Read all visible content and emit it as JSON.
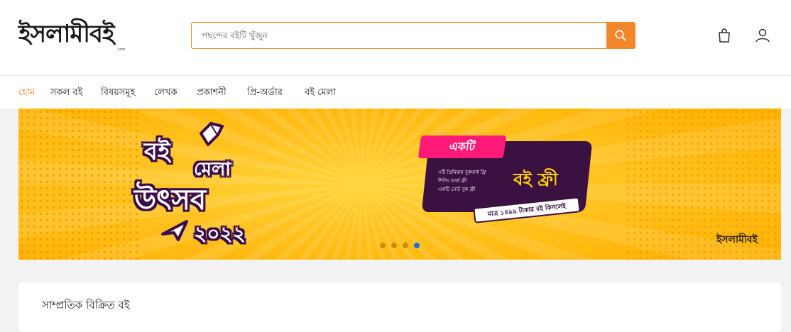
{
  "header": {
    "logo_text": "ইসলামীবই",
    "logo_sub": ".com",
    "search": {
      "placeholder": "পছন্দের বইটি খুঁজুন",
      "value": ""
    },
    "icons": {
      "search": "search-icon",
      "cart": "shopping-bag-icon",
      "account": "user-icon"
    }
  },
  "nav": {
    "items": [
      {
        "label": "হোম",
        "active": true
      },
      {
        "label": "সকল বই"
      },
      {
        "label": "বিষয়সমূহ"
      },
      {
        "label": "লেখক"
      },
      {
        "label": "প্রকাশনী"
      },
      {
        "label": "প্রি-অর্ডার"
      },
      {
        "label": "বই মেলা"
      }
    ]
  },
  "banner": {
    "fair_line1": "বই",
    "fair_line2": "মেলা",
    "fair_line3": "উৎসব",
    "fair_year": "২০২২",
    "offer_tag": "একটি",
    "offer_free": "বই ফ্রী",
    "offer_lines": [
      "৩টি প্রিমিয়াম বুকমার্ক ফ্রি",
      "শিপিং চার্জ ফ্রী",
      "একটি নোট বুক ফ্রী"
    ],
    "offer_price": "মাত্র ১৪৯৯ টাকার বই কিনলেই",
    "logo": "ইসলামীবই",
    "carousel": {
      "count": 4,
      "active_index": 3
    }
  },
  "section": {
    "title": "সাম্প্রতিক বিক্রিত বই"
  },
  "colors": {
    "accent": "#f3852b",
    "banner_purple": "#3a1140",
    "banner_pink": "#ff1a7a",
    "banner_yellow": "#ffc21f"
  }
}
